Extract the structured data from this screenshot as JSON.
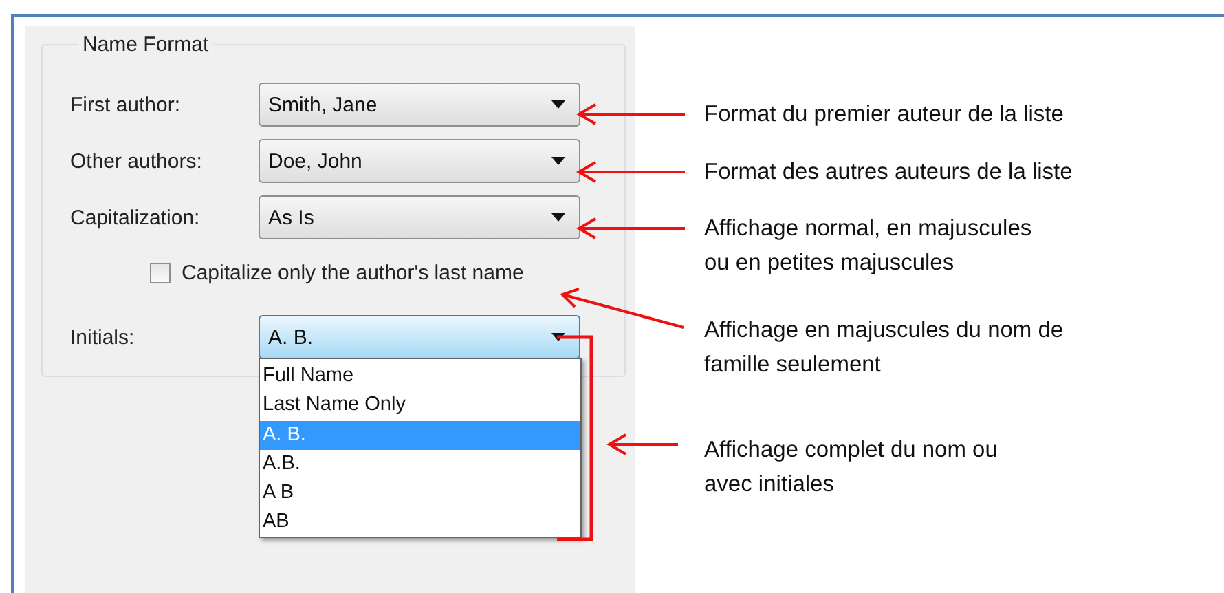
{
  "group": {
    "title": "Name Format",
    "fields": [
      {
        "label": "First author:",
        "value": "Smith, Jane",
        "open": false
      },
      {
        "label": "Other authors:",
        "value": "Doe, John",
        "open": false
      },
      {
        "label": "Capitalization:",
        "value": "As Is",
        "open": false
      }
    ],
    "checkbox": {
      "label": "Capitalize only the author's last name",
      "checked": false
    },
    "initials": {
      "label": "Initials:",
      "value": "A. B.",
      "open": true,
      "options": [
        {
          "label": "Full Name",
          "selected": false
        },
        {
          "label": "Last Name Only",
          "selected": false
        },
        {
          "label": "A. B.",
          "selected": true
        },
        {
          "label": "A.B.",
          "selected": false
        },
        {
          "label": "A B",
          "selected": false
        },
        {
          "label": "AB",
          "selected": false
        }
      ]
    }
  },
  "annotations": [
    "Format du premier auteur de la liste",
    "Format des autres auteurs de la liste",
    "Affichage normal, en majuscules\nou en petites majuscules",
    "Affichage en majuscules du nom de\nfamille seulement",
    "Affichage complet du nom ou\navec initiales"
  ]
}
